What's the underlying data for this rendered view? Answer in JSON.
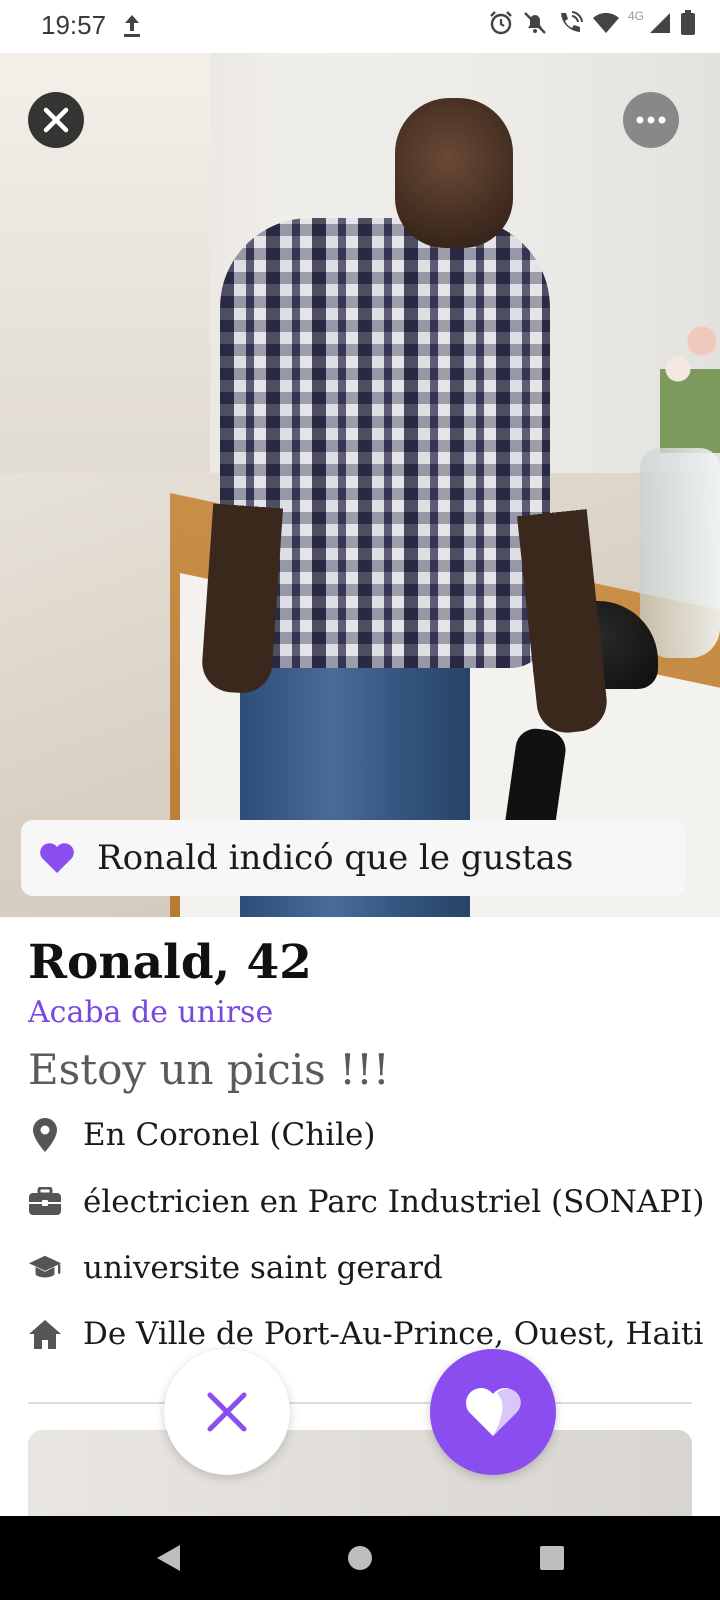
{
  "status_bar": {
    "time": "19:57",
    "network": "4G"
  },
  "profile": {
    "like_banner": "Ronald indicó que le gustas",
    "name_age": "Ronald, 42",
    "status": "Acaba de unirse",
    "bio": "Estoy un picis !!!",
    "details": [
      {
        "icon": "location-pin-icon",
        "text": "En Coronel (Chile)"
      },
      {
        "icon": "briefcase-icon",
        "text": "électricien en Parc Industriel (SONAPI)"
      },
      {
        "icon": "graduation-cap-icon",
        "text": "universite saint gerard"
      },
      {
        "icon": "home-icon",
        "text": "De Ville de Port-Au-Prince, Ouest, Haiti"
      }
    ]
  },
  "colors": {
    "accent": "#8a4df0",
    "accent_text": "#7a47e0"
  }
}
